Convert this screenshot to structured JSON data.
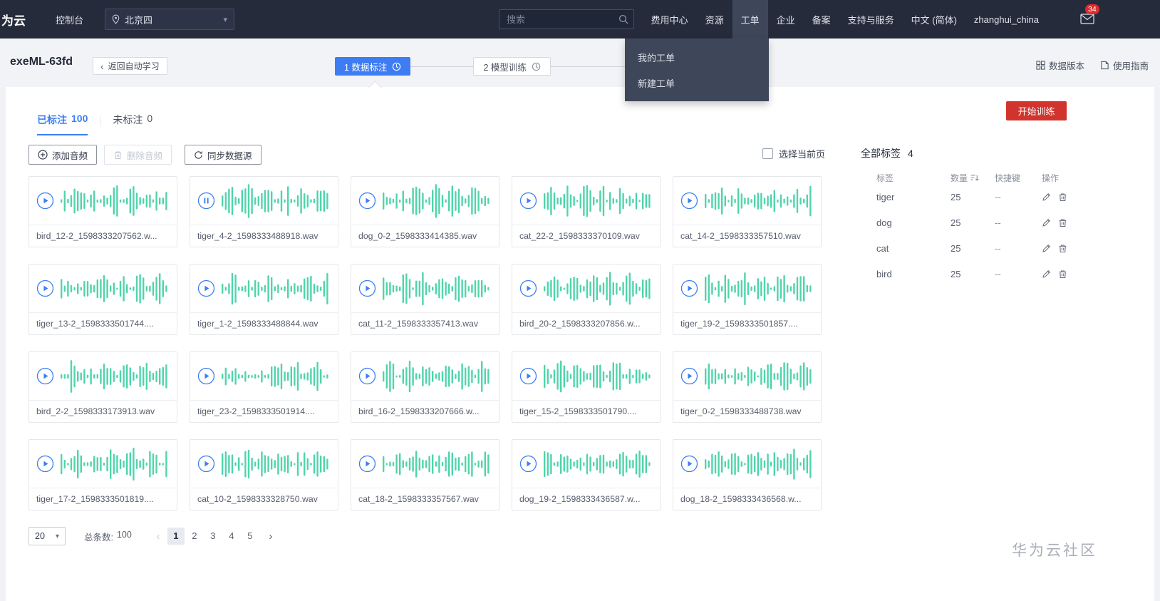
{
  "navbar": {
    "logo_text": "为云",
    "console_label": "控制台",
    "region": {
      "value": "北京四"
    },
    "search": {
      "placeholder": "搜索"
    },
    "menu": [
      {
        "name": "billing-center",
        "label": "费用中心",
        "active": false
      },
      {
        "name": "resources",
        "label": "资源",
        "active": false
      },
      {
        "name": "tickets",
        "label": "工单",
        "active": true
      },
      {
        "name": "enterprise",
        "label": "企业",
        "active": false
      },
      {
        "name": "icp-filing",
        "label": "备案",
        "active": false
      },
      {
        "name": "support",
        "label": "支持与服务",
        "active": false
      },
      {
        "name": "language",
        "label": "中文 (简体)",
        "active": false
      },
      {
        "name": "account",
        "label": "zhanghui_china",
        "active": false
      }
    ],
    "mail_badge": "34"
  },
  "ticket_dropdown": {
    "items": [
      {
        "name": "my-tickets",
        "label": "我的工单"
      },
      {
        "name": "new-ticket",
        "label": "新建工单"
      }
    ]
  },
  "page_header": {
    "title": "exeML-63fd",
    "back_label": "返回自动学习",
    "steps": [
      {
        "label": "1 数据标注",
        "active": true
      },
      {
        "label": "2 模型训练",
        "active": false
      }
    ],
    "data_version_label": "数据版本",
    "guide_label": "使用指南"
  },
  "main": {
    "tabs": [
      {
        "label": "已标注",
        "count": "100",
        "active": true
      },
      {
        "label": "未标注",
        "count": "0",
        "active": false
      }
    ],
    "train_button": "开始训练",
    "toolbar": {
      "add_label": "添加音频",
      "delete_label": "删除音频",
      "sync_label": "同步数据源",
      "select_page_label": "选择当前页"
    },
    "audio_cards": [
      {
        "filename": "bird_12-2_1598333207562.w...",
        "state": "play"
      },
      {
        "filename": "tiger_4-2_1598333488918.wav",
        "state": "pause"
      },
      {
        "filename": "dog_0-2_1598333414385.wav",
        "state": "play"
      },
      {
        "filename": "cat_22-2_1598333370109.wav",
        "state": "play"
      },
      {
        "filename": "cat_14-2_1598333357510.wav",
        "state": "play"
      },
      {
        "filename": "tiger_13-2_1598333501744....",
        "state": "play"
      },
      {
        "filename": "tiger_1-2_1598333488844.wav",
        "state": "play"
      },
      {
        "filename": "cat_11-2_1598333357413.wav",
        "state": "play"
      },
      {
        "filename": "bird_20-2_1598333207856.w...",
        "state": "play"
      },
      {
        "filename": "tiger_19-2_1598333501857....",
        "state": "play"
      },
      {
        "filename": "bird_2-2_1598333173913.wav",
        "state": "play"
      },
      {
        "filename": "tiger_23-2_1598333501914....",
        "state": "play"
      },
      {
        "filename": "bird_16-2_1598333207666.w...",
        "state": "play"
      },
      {
        "filename": "tiger_15-2_1598333501790....",
        "state": "play"
      },
      {
        "filename": "tiger_0-2_1598333488738.wav",
        "state": "play"
      },
      {
        "filename": "tiger_17-2_1598333501819....",
        "state": "play"
      },
      {
        "filename": "cat_10-2_1598333328750.wav",
        "state": "play"
      },
      {
        "filename": "cat_18-2_1598333357567.wav",
        "state": "play"
      },
      {
        "filename": "dog_19-2_1598333436587.w...",
        "state": "play"
      },
      {
        "filename": "dog_18-2_1598333436568.w...",
        "state": "play"
      }
    ],
    "pagination": {
      "page_size": "20",
      "total_label": "总条数:",
      "total": "100",
      "pages": [
        "1",
        "2",
        "3",
        "4",
        "5"
      ],
      "current_page": "1"
    }
  },
  "labels_panel": {
    "title": "全部标签",
    "count": "4",
    "columns": [
      "标签",
      "数量",
      "快捷键",
      "操作"
    ],
    "rows": [
      {
        "label": "tiger",
        "count": "25",
        "shortcut": "--"
      },
      {
        "label": "dog",
        "count": "25",
        "shortcut": "--"
      },
      {
        "label": "cat",
        "count": "25",
        "shortcut": "--"
      },
      {
        "label": "bird",
        "count": "25",
        "shortcut": "--"
      }
    ]
  },
  "watermark": "华为云社区",
  "colors": {
    "accent_blue": "#3d7ff3",
    "danger_red": "#d0342c",
    "waveform_green": "#50d4ab",
    "navbar_bg": "#252b3a"
  }
}
